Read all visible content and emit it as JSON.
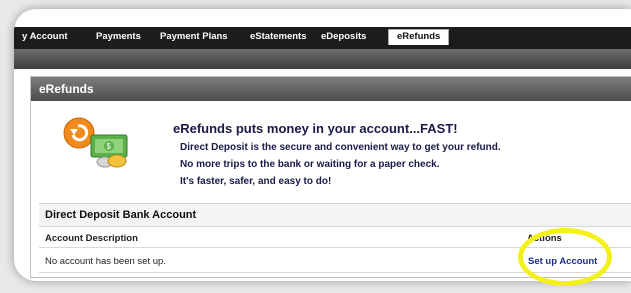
{
  "nav": {
    "tabs": [
      {
        "label": "y Account"
      },
      {
        "label": "Payments"
      },
      {
        "label": "Payment Plans"
      },
      {
        "label": "eStatements"
      },
      {
        "label": "eDeposits"
      },
      {
        "label": "eRefunds",
        "active": true
      }
    ]
  },
  "panel": {
    "title": "eRefunds",
    "headline": "eRefunds puts money in your account...FAST!",
    "lines": [
      "Direct Deposit is the secure and convenient way to get your refund.",
      "No more trips to the bank or waiting for a paper check.",
      "It's faster, safer, and easy to do!"
    ],
    "icon": "refund-money-icon"
  },
  "bank": {
    "title": "Direct Deposit Bank Account",
    "columns": [
      "Account Description",
      "Actions"
    ],
    "rows": [
      {
        "description": "No account has been set up.",
        "action": "Set up Account"
      }
    ]
  },
  "colors": {
    "highlight": "#f3f01a",
    "link": "#1b2f8f",
    "nav": "#1c1c1c"
  }
}
